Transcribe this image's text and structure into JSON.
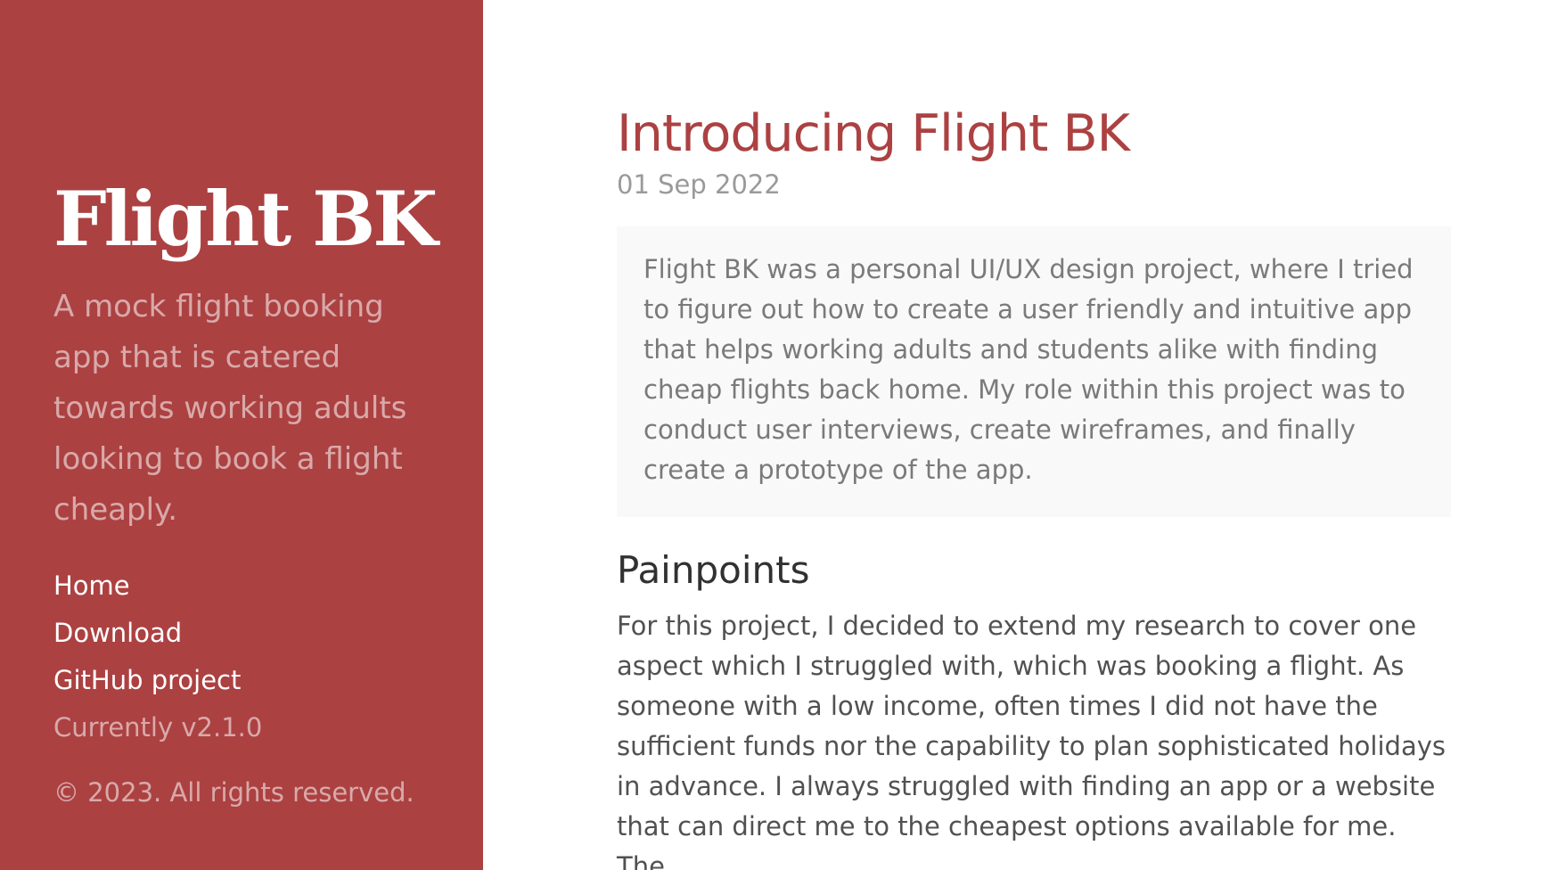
{
  "sidebar": {
    "brand": "Flight BK",
    "lead": "A mock flight booking app that is catered towards working adults looking to book a flight cheaply.",
    "nav": {
      "home": "Home",
      "download": "Download",
      "github": "GitHub project",
      "version": "Currently v2.1.0"
    },
    "copyright": "© 2023. All rights reserved."
  },
  "post": {
    "title": "Introducing Flight BK",
    "date": "01 Sep 2022",
    "intro": "Flight BK was a personal UI/UX design project, where I tried to figure out how to create a user friendly and intuitive app that helps working adults and students alike with finding cheap flights back home. My role within this project was to conduct user interviews, create wireframes, and finally create a prototype of the app.",
    "section_heading": "Painpoints",
    "section_text": "For this project, I decided to extend my research to cover one aspect which I struggled with, which was booking a flight. As someone with a low income, often times I did not have the sufficient funds nor the capability to plan sophisticated holidays in advance. I always struggled with finding an app or a website that can direct me to the cheapest options available for me. The"
  },
  "colors": {
    "accent": "#ac4142",
    "intro_background": "#f9f9f9"
  }
}
